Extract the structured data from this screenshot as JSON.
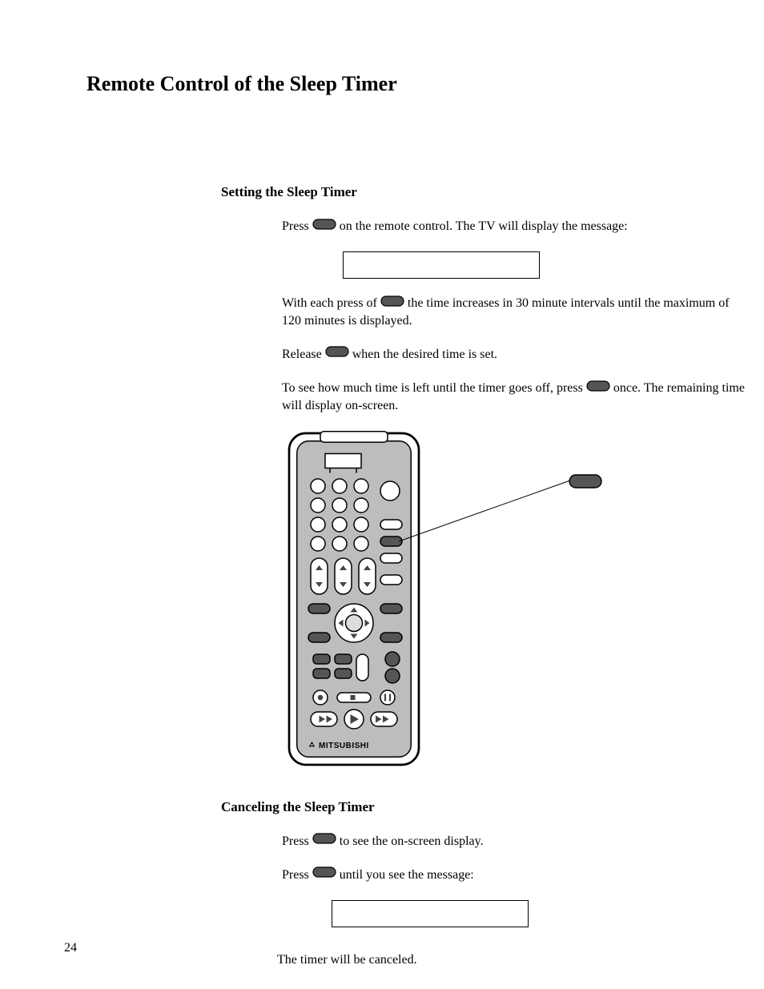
{
  "page": {
    "title": "Remote Control of the Sleep Timer",
    "number": "24"
  },
  "setting": {
    "heading": "Setting the Sleep Timer",
    "p1a": "Press",
    "p1b": "on the remote control.  The TV will display the message:",
    "p2a": "With each press of",
    "p2b": "the time increases in 30 minute intervals until the maximum of 120 minutes is displayed.",
    "p3a": "Release",
    "p3b": "when the desired time is set.",
    "p4a": "To see how much time is left until the timer goes off, press",
    "p4b": "once.  The remaining time will display on-screen."
  },
  "remote": {
    "brand": "MITSUBISHI"
  },
  "cancel": {
    "heading": "Canceling the Sleep Timer",
    "p1a": "Press",
    "p1b": "to see the on-screen display.",
    "p2a": "Press",
    "p2b": "until you see the message:",
    "p3": "The timer will be canceled."
  }
}
